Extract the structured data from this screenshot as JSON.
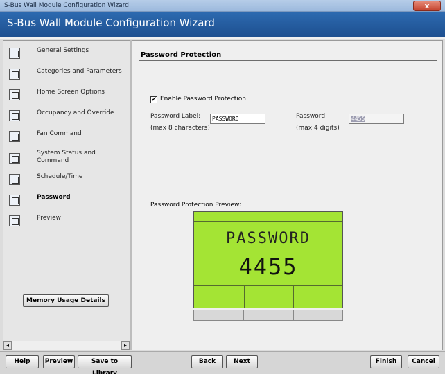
{
  "window": {
    "title": "S-Bus Wall Module Configuration Wizard",
    "close_glyph": "x"
  },
  "header": {
    "title": "S-Bus Wall Module Configuration Wizard"
  },
  "sidebar": {
    "items": [
      {
        "label": "General Settings",
        "icon": "general-settings-icon",
        "active": false
      },
      {
        "label": "Categories and Parameters",
        "icon": "categories-icon",
        "active": false
      },
      {
        "label": "Home Screen Options",
        "icon": "home-screen-icon",
        "active": false
      },
      {
        "label": "Occupancy and Override",
        "icon": "occupancy-icon",
        "active": false
      },
      {
        "label": "Fan Command",
        "icon": "fan-icon",
        "active": false
      },
      {
        "label": "System Status and Command",
        "icon": "system-status-icon",
        "active": false
      },
      {
        "label": "Schedule/Time",
        "icon": "schedule-icon",
        "active": false
      },
      {
        "label": "Password",
        "icon": "password-icon",
        "active": true
      },
      {
        "label": "Preview",
        "icon": "preview-icon",
        "active": false
      }
    ],
    "memory_button": "Memory Usage Details",
    "scroll_left": "◂",
    "scroll_right": "▸"
  },
  "content": {
    "section_title": "Password Protection",
    "enable_checkbox": {
      "label": "Enable Password Protection",
      "checked": true,
      "mark": "✔"
    },
    "password_label": {
      "label": "Password Label:",
      "hint": "(max 8 characters)",
      "value": "PASSWORD"
    },
    "password": {
      "label": "Password:",
      "hint": "(max 4 digits)",
      "value": "4455"
    },
    "preview_title": "Password Protection Preview:",
    "lcd": {
      "line1": "PASSWORD",
      "line2": "4455",
      "background": "#a4e434"
    }
  },
  "footer": {
    "help": "Help",
    "preview": "Preview",
    "save_to_library": "Save to Library",
    "back": "Back",
    "next": "Next",
    "finish": "Finish",
    "cancel": "Cancel"
  }
}
